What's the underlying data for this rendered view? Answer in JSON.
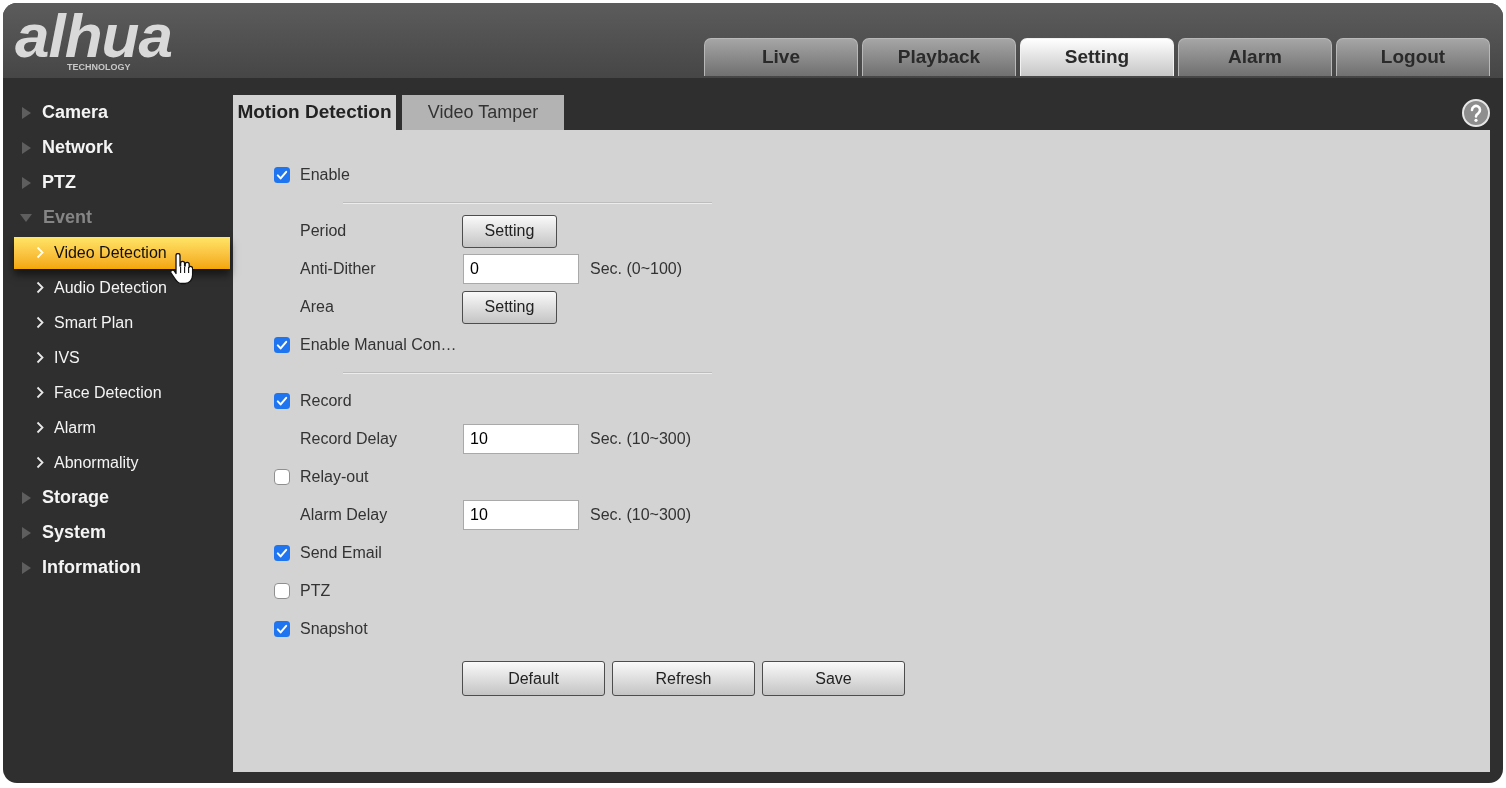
{
  "header": {
    "logo": {
      "wordmark": "alhua",
      "tagline": "TECHNOLOGY"
    },
    "nav_tabs": [
      {
        "label": "Live",
        "selected": false
      },
      {
        "label": "Playback",
        "selected": false
      },
      {
        "label": "Setting",
        "selected": true
      },
      {
        "label": "Alarm",
        "selected": false
      },
      {
        "label": "Logout",
        "selected": false
      }
    ]
  },
  "sidebar": {
    "items": [
      {
        "label": "Camera",
        "expanded": false
      },
      {
        "label": "Network",
        "expanded": false
      },
      {
        "label": "PTZ",
        "expanded": false
      },
      {
        "label": "Event",
        "expanded": true,
        "children": [
          {
            "label": "Video Detection",
            "selected": true
          },
          {
            "label": "Audio Detection",
            "selected": false
          },
          {
            "label": "Smart Plan",
            "selected": false
          },
          {
            "label": "IVS",
            "selected": false
          },
          {
            "label": "Face Detection",
            "selected": false
          },
          {
            "label": "Alarm",
            "selected": false
          },
          {
            "label": "Abnormality",
            "selected": false
          }
        ]
      },
      {
        "label": "Storage",
        "expanded": false
      },
      {
        "label": "System",
        "expanded": false
      },
      {
        "label": "Information",
        "expanded": false
      }
    ]
  },
  "content": {
    "tabs": [
      {
        "label": "Motion Detection",
        "selected": true
      },
      {
        "label": "Video Tamper",
        "selected": false
      }
    ],
    "form": {
      "rows": [
        {
          "kind": "checkbox",
          "label": "Enable",
          "checked": true
        },
        {
          "kind": "divider"
        },
        {
          "kind": "button",
          "label": "Period",
          "button": "Setting"
        },
        {
          "kind": "input",
          "label": "Anti-Dither",
          "value": "0",
          "unit": "Sec. (0~100)"
        },
        {
          "kind": "button",
          "label": "Area",
          "button": "Setting"
        },
        {
          "kind": "checkbox",
          "label": "Enable Manual Con…",
          "checked": true
        },
        {
          "kind": "divider"
        },
        {
          "kind": "checkbox",
          "label": "Record",
          "checked": true
        },
        {
          "kind": "input",
          "label": "Record Delay",
          "value": "10",
          "unit": "Sec. (10~300)"
        },
        {
          "kind": "checkbox",
          "label": "Relay-out",
          "checked": false
        },
        {
          "kind": "input",
          "label": "Alarm Delay",
          "value": "10",
          "unit": "Sec. (10~300)"
        },
        {
          "kind": "checkbox",
          "label": "Send Email",
          "checked": true
        },
        {
          "kind": "checkbox",
          "label": "PTZ",
          "checked": false
        },
        {
          "kind": "checkbox",
          "label": "Snapshot",
          "checked": true
        }
      ],
      "buttons": [
        "Default",
        "Refresh",
        "Save"
      ]
    }
  }
}
